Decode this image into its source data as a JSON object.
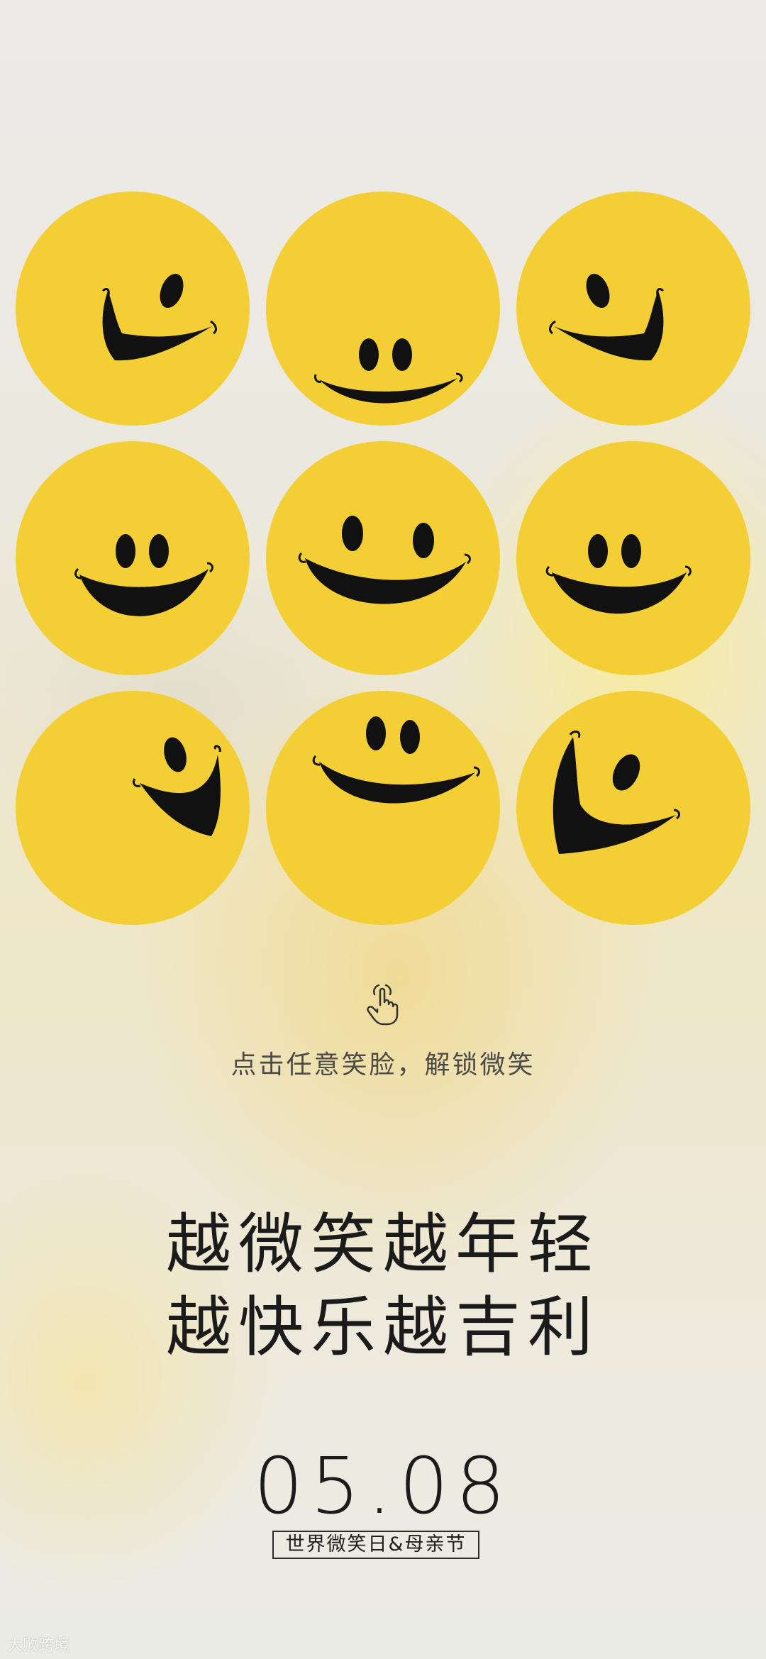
{
  "hint": "点击任意笑脸，解锁微笑",
  "slogan": {
    "line1": "越微笑越年轻",
    "line2": "越快乐越吉利"
  },
  "date": "05.08",
  "event": "世界微笑日&母亲节",
  "watermark": "大败跨境",
  "faces": [
    {
      "icon": "smiley-face-icon"
    },
    {
      "icon": "smiley-face-icon"
    },
    {
      "icon": "smiley-face-icon"
    },
    {
      "icon": "smiley-face-icon"
    },
    {
      "icon": "smiley-face-icon"
    },
    {
      "icon": "smiley-face-icon"
    },
    {
      "icon": "smiley-face-icon"
    },
    {
      "icon": "smiley-face-icon"
    },
    {
      "icon": "smiley-face-icon"
    }
  ],
  "tap_icon": "tap-hand-icon",
  "colors": {
    "face_yellow": "#f3cf35",
    "ink": "#111111",
    "text": "#1b1b1b",
    "hint_text": "#4b4a46"
  }
}
